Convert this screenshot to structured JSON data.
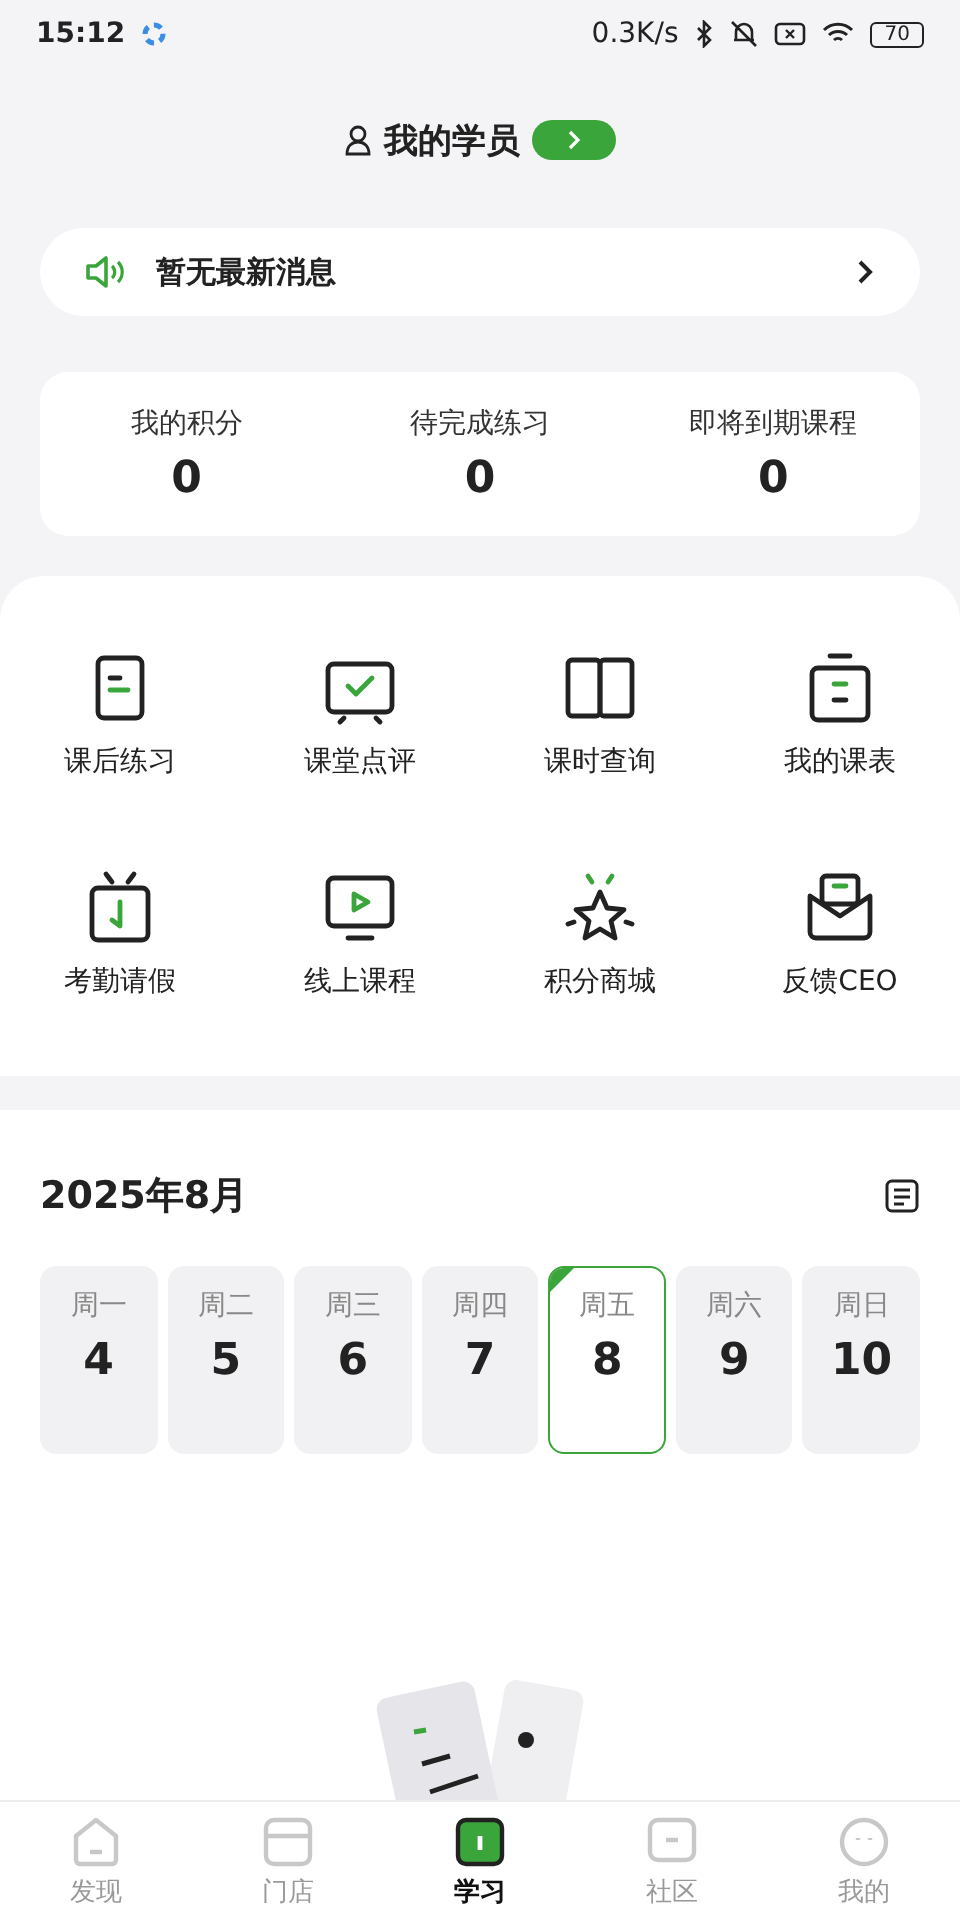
{
  "status_bar": {
    "time": "15:12",
    "speed": "0.3K/s",
    "battery": "70"
  },
  "header": {
    "title": "我的学员"
  },
  "notice": {
    "text": "暂无最新消息"
  },
  "stats": [
    {
      "label": "我的积分",
      "value": "0"
    },
    {
      "label": "待完成练习",
      "value": "0"
    },
    {
      "label": "即将到期课程",
      "value": "0"
    }
  ],
  "features": [
    {
      "label": "课后练习",
      "kind": "doc"
    },
    {
      "label": "课堂点评",
      "kind": "review"
    },
    {
      "label": "课时查询",
      "kind": "book"
    },
    {
      "label": "我的课表",
      "kind": "schedule"
    },
    {
      "label": "考勤请假",
      "kind": "clock"
    },
    {
      "label": "线上课程",
      "kind": "play"
    },
    {
      "label": "积分商城",
      "kind": "star"
    },
    {
      "label": "反馈CEO",
      "kind": "mail"
    }
  ],
  "calendar": {
    "month": "2025年8月",
    "days": [
      {
        "weekday": "周一",
        "date": "4",
        "selected": false
      },
      {
        "weekday": "周二",
        "date": "5",
        "selected": false
      },
      {
        "weekday": "周三",
        "date": "6",
        "selected": false
      },
      {
        "weekday": "周四",
        "date": "7",
        "selected": false
      },
      {
        "weekday": "周五",
        "date": "8",
        "selected": true
      },
      {
        "weekday": "周六",
        "date": "9",
        "selected": false
      },
      {
        "weekday": "周日",
        "date": "10",
        "selected": false
      }
    ]
  },
  "tabs": [
    {
      "label": "发现",
      "kind": "home",
      "selected": false
    },
    {
      "label": "门店",
      "kind": "store",
      "selected": false
    },
    {
      "label": "学习",
      "kind": "study",
      "selected": true
    },
    {
      "label": "社区",
      "kind": "chat",
      "selected": false
    },
    {
      "label": "我的",
      "kind": "face",
      "selected": false
    }
  ]
}
